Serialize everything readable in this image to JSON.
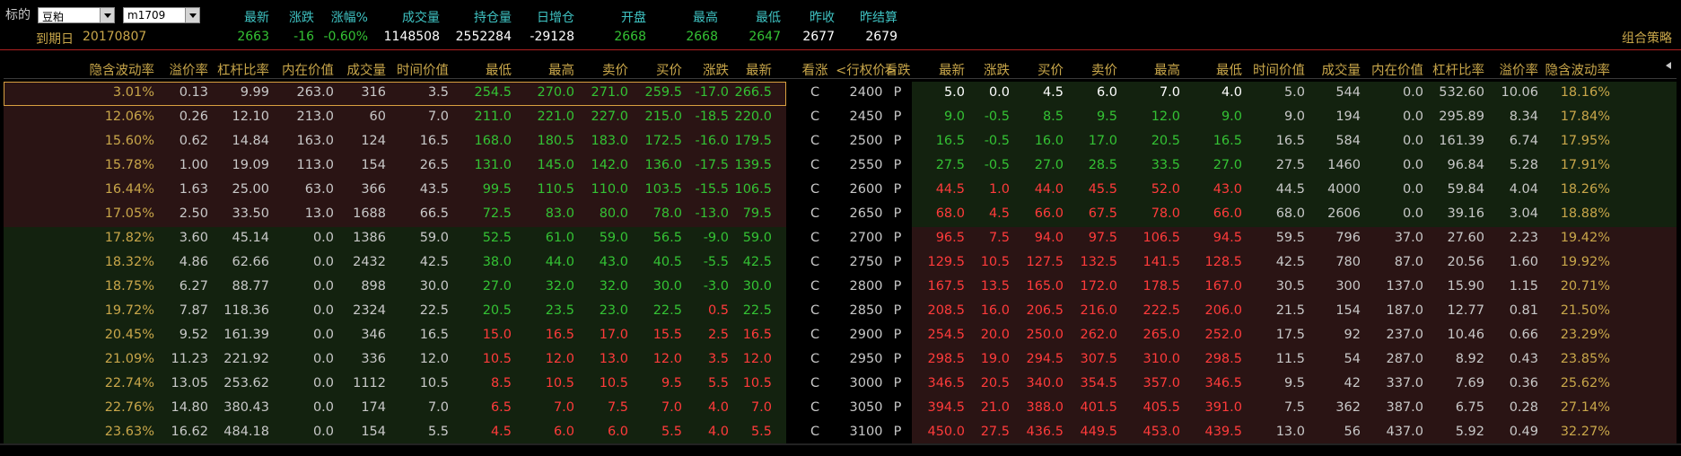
{
  "header": {
    "symbol_label": "标的",
    "symbol_value": "豆粕",
    "contract_value": "m1709",
    "expiry_label": "到期日",
    "expiry_value": "20170807",
    "labels": [
      "最新",
      "涨跌",
      "涨幅%",
      "成交量",
      "持仓量",
      "日增仓",
      "开盘",
      "最高",
      "最低",
      "昨收",
      "昨结算"
    ],
    "values": [
      "2663",
      "-16",
      "-0.60%",
      "1148508",
      "2552284",
      "-29128",
      "2668",
      "2668",
      "2647",
      "2677",
      "2679"
    ],
    "strategy_label": "组合策略"
  },
  "table": {
    "call_headers": [
      "隐含波动率",
      "溢价率",
      "杠杆比率",
      "内在价值",
      "成交量",
      "时间价值",
      "最低",
      "最高",
      "卖价",
      "买价",
      "涨跌",
      "最新"
    ],
    "mid_headers": [
      "看涨",
      "<行权价>",
      "看跌"
    ],
    "put_headers": [
      "最新",
      "涨跌",
      "买价",
      "卖价",
      "最高",
      "最低",
      "时间价值",
      "成交量",
      "内在价值",
      "杠杆比率",
      "溢价率",
      "隐含波动率"
    ],
    "scroll_left_icon": "chevron-left-icon",
    "rows": [
      {
        "call": [
          "3.01%",
          "0.13",
          "9.99",
          "263.0",
          "316",
          "3.5",
          "254.5",
          "270.0",
          "271.0",
          "259.5",
          "-17.0",
          "266.5"
        ],
        "c": "C",
        "strike": "2400",
        "p": "P",
        "put": [
          "5.0",
          "0.0",
          "4.5",
          "6.0",
          "7.0",
          "4.0",
          "5.0",
          "544",
          "0.0",
          "532.60",
          "10.06",
          "18.16%"
        ]
      },
      {
        "call": [
          "12.06%",
          "0.26",
          "12.10",
          "213.0",
          "60",
          "7.0",
          "211.0",
          "221.0",
          "227.0",
          "215.0",
          "-18.5",
          "220.0"
        ],
        "c": "C",
        "strike": "2450",
        "p": "P",
        "put": [
          "9.0",
          "-0.5",
          "8.5",
          "9.5",
          "12.0",
          "9.0",
          "9.0",
          "194",
          "0.0",
          "295.89",
          "8.34",
          "17.84%"
        ]
      },
      {
        "call": [
          "15.60%",
          "0.62",
          "14.84",
          "163.0",
          "124",
          "16.5",
          "168.0",
          "180.5",
          "183.0",
          "172.5",
          "-16.0",
          "179.5"
        ],
        "c": "C",
        "strike": "2500",
        "p": "P",
        "put": [
          "16.5",
          "-0.5",
          "16.0",
          "17.0",
          "20.5",
          "16.5",
          "16.5",
          "584",
          "0.0",
          "161.39",
          "6.74",
          "17.95%"
        ]
      },
      {
        "call": [
          "15.78%",
          "1.00",
          "19.09",
          "113.0",
          "154",
          "26.5",
          "131.0",
          "145.0",
          "142.0",
          "136.0",
          "-17.5",
          "139.5"
        ],
        "c": "C",
        "strike": "2550",
        "p": "P",
        "put": [
          "27.5",
          "-0.5",
          "27.0",
          "28.5",
          "33.5",
          "27.0",
          "27.5",
          "1460",
          "0.0",
          "96.84",
          "5.28",
          "17.91%"
        ]
      },
      {
        "call": [
          "16.44%",
          "1.63",
          "25.00",
          "63.0",
          "366",
          "43.5",
          "99.5",
          "110.5",
          "110.0",
          "103.5",
          "-15.5",
          "106.5"
        ],
        "c": "C",
        "strike": "2600",
        "p": "P",
        "put": [
          "44.5",
          "1.0",
          "44.0",
          "45.5",
          "52.0",
          "43.0",
          "44.5",
          "4000",
          "0.0",
          "59.84",
          "4.04",
          "18.26%"
        ]
      },
      {
        "call": [
          "17.05%",
          "2.50",
          "33.50",
          "13.0",
          "1688",
          "66.5",
          "72.5",
          "83.0",
          "80.0",
          "78.0",
          "-13.0",
          "79.5"
        ],
        "c": "C",
        "strike": "2650",
        "p": "P",
        "put": [
          "68.0",
          "4.5",
          "66.0",
          "67.5",
          "78.0",
          "66.0",
          "68.0",
          "2606",
          "0.0",
          "39.16",
          "3.04",
          "18.88%"
        ]
      },
      {
        "call": [
          "17.82%",
          "3.60",
          "45.14",
          "0.0",
          "1386",
          "59.0",
          "52.5",
          "61.0",
          "59.0",
          "56.5",
          "-9.0",
          "59.0"
        ],
        "c": "C",
        "strike": "2700",
        "p": "P",
        "put": [
          "96.5",
          "7.5",
          "94.0",
          "97.5",
          "106.5",
          "94.5",
          "59.5",
          "796",
          "37.0",
          "27.60",
          "2.23",
          "19.42%"
        ]
      },
      {
        "call": [
          "18.32%",
          "4.86",
          "62.66",
          "0.0",
          "2432",
          "42.5",
          "38.0",
          "44.0",
          "43.0",
          "40.5",
          "-5.5",
          "42.5"
        ],
        "c": "C",
        "strike": "2750",
        "p": "P",
        "put": [
          "129.5",
          "10.5",
          "127.5",
          "132.5",
          "141.5",
          "128.5",
          "42.5",
          "780",
          "87.0",
          "20.56",
          "1.60",
          "19.92%"
        ]
      },
      {
        "call": [
          "18.75%",
          "6.27",
          "88.77",
          "0.0",
          "898",
          "30.0",
          "27.0",
          "32.0",
          "32.0",
          "30.0",
          "-3.0",
          "30.0"
        ],
        "c": "C",
        "strike": "2800",
        "p": "P",
        "put": [
          "167.5",
          "13.5",
          "165.0",
          "172.0",
          "178.5",
          "167.0",
          "30.5",
          "300",
          "137.0",
          "15.90",
          "1.15",
          "20.71%"
        ]
      },
      {
        "call": [
          "19.72%",
          "7.87",
          "118.36",
          "0.0",
          "2324",
          "22.5",
          "20.5",
          "23.5",
          "23.0",
          "22.5",
          "0.5",
          "22.5"
        ],
        "c": "C",
        "strike": "2850",
        "p": "P",
        "put": [
          "208.5",
          "16.0",
          "206.5",
          "216.0",
          "222.5",
          "206.0",
          "21.5",
          "154",
          "187.0",
          "12.77",
          "0.81",
          "21.50%"
        ]
      },
      {
        "call": [
          "20.45%",
          "9.52",
          "161.39",
          "0.0",
          "346",
          "16.5",
          "15.0",
          "16.5",
          "17.0",
          "15.5",
          "2.5",
          "16.5"
        ],
        "c": "C",
        "strike": "2900",
        "p": "P",
        "put": [
          "254.5",
          "20.0",
          "250.0",
          "262.0",
          "265.0",
          "252.0",
          "17.5",
          "92",
          "237.0",
          "10.46",
          "0.66",
          "23.29%"
        ]
      },
      {
        "call": [
          "21.09%",
          "11.23",
          "221.92",
          "0.0",
          "336",
          "12.0",
          "10.5",
          "12.0",
          "13.0",
          "12.0",
          "3.5",
          "12.0"
        ],
        "c": "C",
        "strike": "2950",
        "p": "P",
        "put": [
          "298.5",
          "19.0",
          "294.5",
          "307.5",
          "310.0",
          "298.5",
          "11.5",
          "54",
          "287.0",
          "8.92",
          "0.43",
          "23.85%"
        ]
      },
      {
        "call": [
          "22.74%",
          "13.05",
          "253.62",
          "0.0",
          "1112",
          "10.5",
          "8.5",
          "10.5",
          "10.5",
          "9.5",
          "5.5",
          "10.5"
        ],
        "c": "C",
        "strike": "3000",
        "p": "P",
        "put": [
          "346.5",
          "20.5",
          "340.0",
          "354.5",
          "357.0",
          "346.5",
          "9.5",
          "42",
          "337.0",
          "7.69",
          "0.36",
          "25.62%"
        ]
      },
      {
        "call": [
          "22.76%",
          "14.80",
          "380.43",
          "0.0",
          "174",
          "7.0",
          "6.5",
          "7.0",
          "7.5",
          "7.0",
          "4.0",
          "7.0"
        ],
        "c": "C",
        "strike": "3050",
        "p": "P",
        "put": [
          "394.5",
          "21.0",
          "388.0",
          "401.5",
          "405.5",
          "391.0",
          "7.5",
          "362",
          "387.0",
          "6.75",
          "0.28",
          "27.14%"
        ]
      },
      {
        "call": [
          "23.63%",
          "16.62",
          "484.18",
          "0.0",
          "154",
          "5.5",
          "4.5",
          "6.0",
          "6.0",
          "5.5",
          "4.0",
          "5.5"
        ],
        "c": "C",
        "strike": "3100",
        "p": "P",
        "put": [
          "450.0",
          "27.5",
          "436.5",
          "449.5",
          "453.0",
          "439.5",
          "13.0",
          "56",
          "437.0",
          "5.92",
          "0.49",
          "32.27%"
        ]
      }
    ]
  },
  "colors": {
    "red": "#ff3b3b",
    "green": "#34c234",
    "gold": "#c8a64a",
    "cyan": "#3fc3c3",
    "call_itm_bg": "#2a1414",
    "call_otm_bg": "#13220f",
    "put_itm_bg": "#2a1414",
    "put_otm_bg": "#13220f"
  }
}
